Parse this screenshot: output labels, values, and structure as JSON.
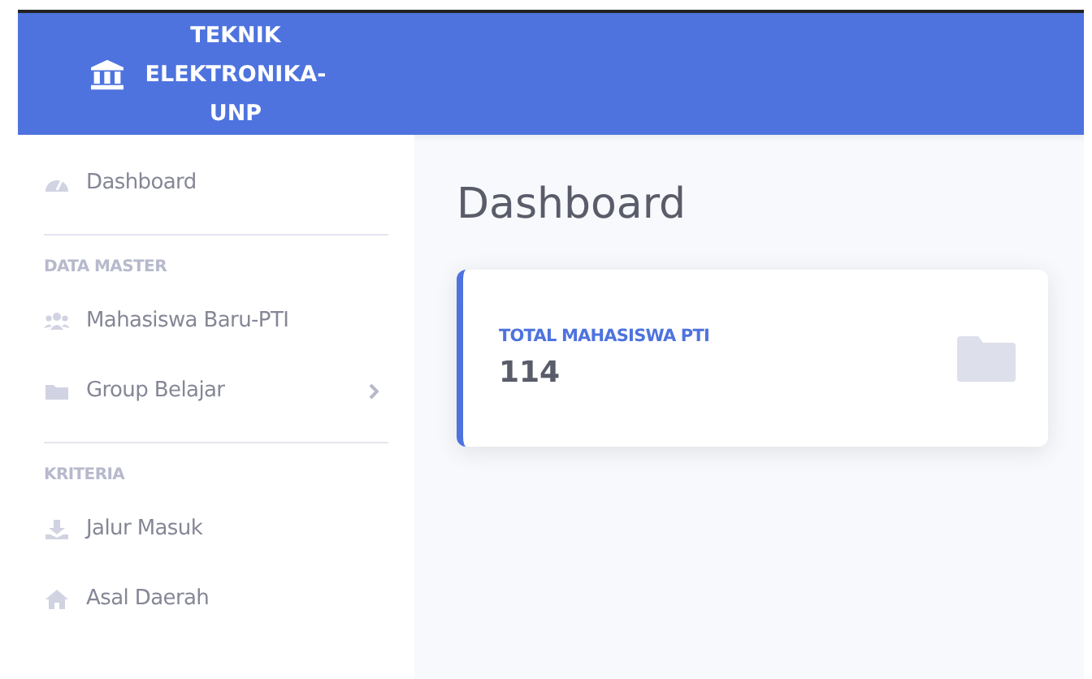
{
  "brand": {
    "title_lines": [
      "TEKNIK",
      "ELEKTRONIKA-",
      "UNP"
    ]
  },
  "sidebar": {
    "sections": [
      {
        "items": [
          {
            "label": "Dashboard",
            "has_submenu": false
          }
        ]
      },
      {
        "heading": "DATA MASTER",
        "items": [
          {
            "label": "Mahasiswa Baru-PTI",
            "has_submenu": false
          },
          {
            "label": "Group Belajar",
            "has_submenu": true
          }
        ]
      },
      {
        "heading": "KRITERIA",
        "items": [
          {
            "label": "Jalur Masuk",
            "has_submenu": false
          },
          {
            "label": "Asal Daerah",
            "has_submenu": false
          }
        ]
      }
    ]
  },
  "page_title": "Dashboard",
  "cards": [
    {
      "label": "TOTAL MAHASISWA PTI",
      "value": "114"
    }
  ]
}
